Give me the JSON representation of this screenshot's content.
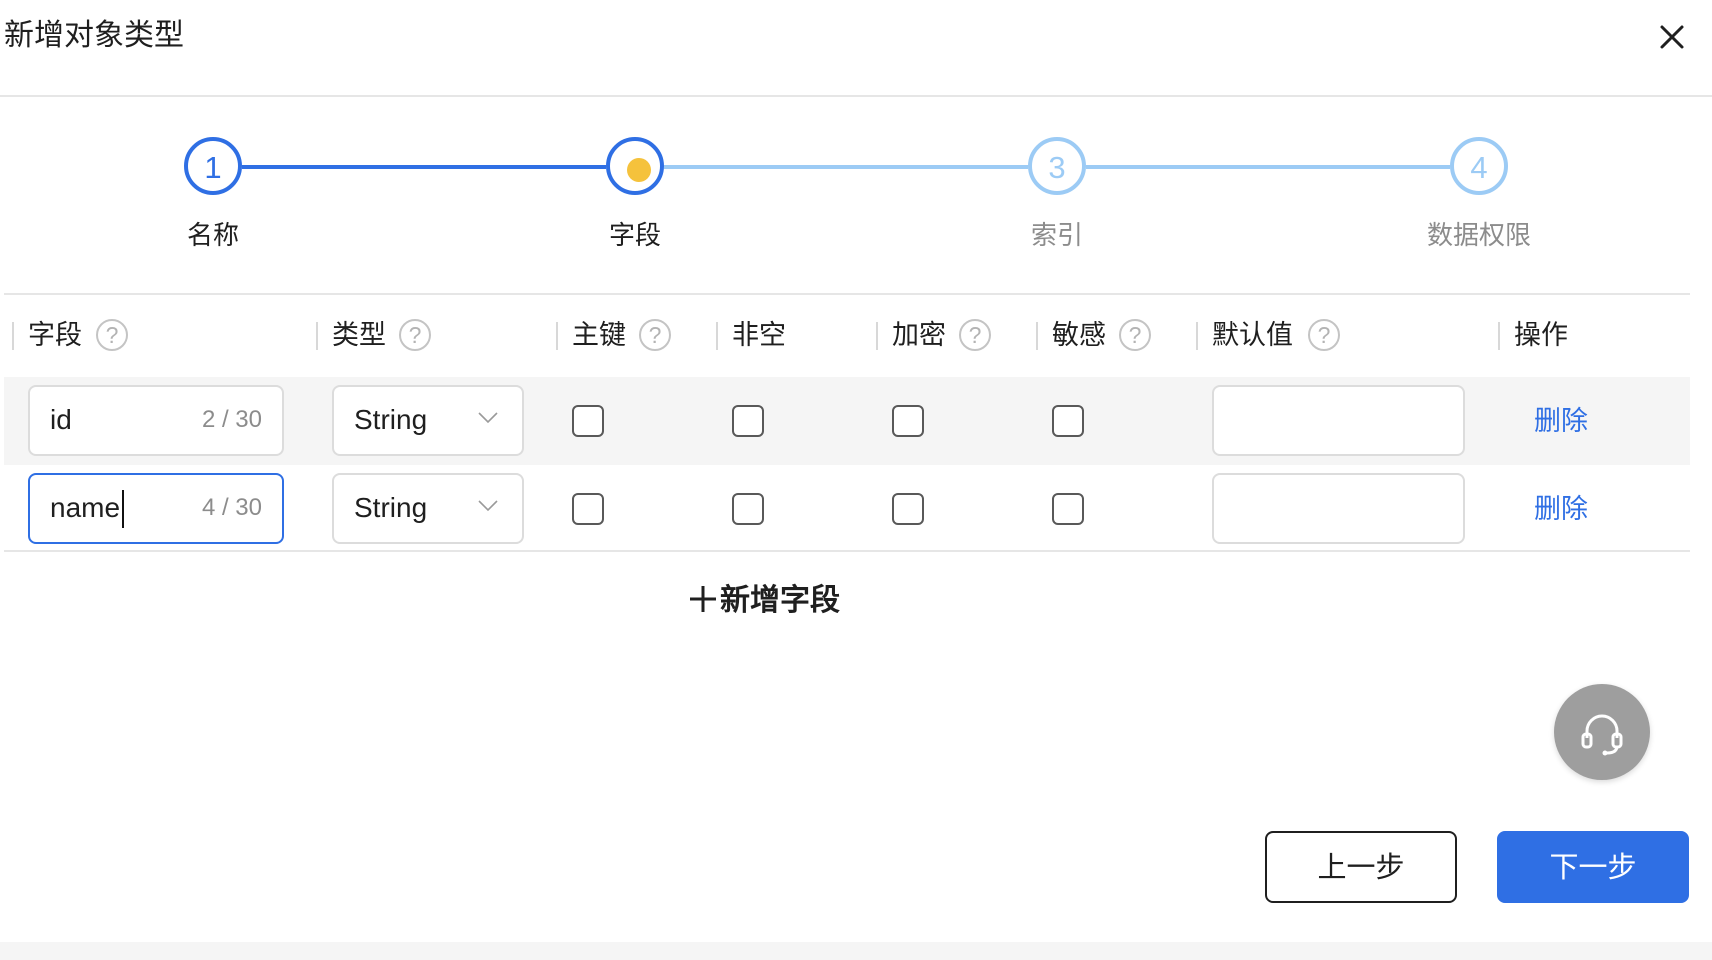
{
  "dialog": {
    "title": "新增对象类型",
    "close_icon": "close-icon"
  },
  "steps": [
    {
      "number": "1",
      "label": "名称",
      "state": "done"
    },
    {
      "number": "2",
      "label": "字段",
      "state": "current"
    },
    {
      "number": "3",
      "label": "索引",
      "state": "wait"
    },
    {
      "number": "4",
      "label": "数据权限",
      "state": "wait"
    }
  ],
  "colors": {
    "primary": "#2f6fe4",
    "step_wait": "#9ccbf5",
    "step_current_dot": "#f5c23c",
    "help_icon": "#b3b3b3",
    "row_highlight": "#f5f5f5"
  },
  "table": {
    "headers": {
      "field": "字段",
      "type": "类型",
      "primary_key": "主键",
      "not_null": "非空",
      "encrypted": "加密",
      "sensitive": "敏感",
      "default_value": "默认值",
      "actions": "操作"
    },
    "help_icon": "?",
    "rows": [
      {
        "name": "id",
        "count": "2 / 30",
        "type": "String",
        "primary_key": false,
        "not_null": false,
        "encrypted": false,
        "sensitive": false,
        "default_value": "",
        "action": "删除"
      },
      {
        "name": "name",
        "count": "4 / 30",
        "type": "String",
        "primary_key": false,
        "not_null": false,
        "encrypted": false,
        "sensitive": false,
        "default_value": "",
        "action": "删除"
      }
    ]
  },
  "add_field": {
    "icon": "plus-icon",
    "label": "新增字段"
  },
  "support_button": {
    "icon": "headset-icon"
  },
  "buttons": {
    "prev": "上一步",
    "next": "下一步"
  }
}
